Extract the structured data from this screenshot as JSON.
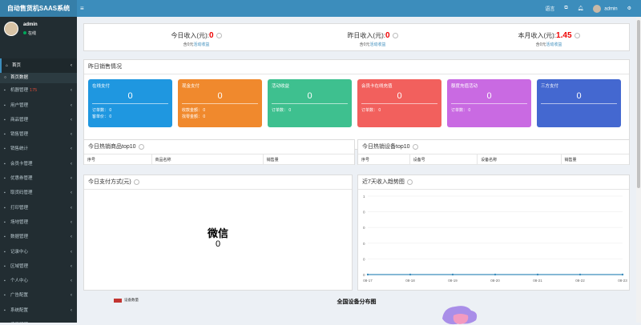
{
  "app": {
    "brand": "自动售货机SAAS系统",
    "toggle": "≡"
  },
  "header": {
    "lang": "语言",
    "user": "admin"
  },
  "sidebar": {
    "user": {
      "name": "admin",
      "status": "在线"
    },
    "items": [
      {
        "label": "首页",
        "icon": "home-icon",
        "active": true
      },
      {
        "label": "首页数据",
        "sub": true
      },
      {
        "label": "机器管理",
        "badge": "175"
      },
      {
        "label": "用户管理"
      },
      {
        "label": "商品管理"
      },
      {
        "label": "销售管理"
      },
      {
        "label": "销售统计"
      },
      {
        "label": "会员卡管理"
      },
      {
        "label": "优惠券管理"
      },
      {
        "label": "取货码管理"
      },
      {
        "label": "打印管理"
      },
      {
        "label": "场地管理"
      },
      {
        "label": "数据管理"
      },
      {
        "label": "记录中心"
      },
      {
        "label": "区域管理"
      },
      {
        "label": "个人中心"
      },
      {
        "label": "广告配置"
      },
      {
        "label": "系统配置"
      },
      {
        "label": "场景管理"
      }
    ]
  },
  "kpi": [
    {
      "label": "今日收入(元):",
      "value": "0",
      "sub1": "含0元",
      "sub2": "活动收益"
    },
    {
      "label": "昨日收入(元):",
      "value": "0",
      "sub1": "含0元",
      "sub2": "活动收益"
    },
    {
      "label": "本月收入(元):",
      "value": "1.45",
      "sub1": "含0元",
      "sub2": "活动收益"
    }
  ],
  "sales": {
    "title": "昨日销售情况",
    "cards": [
      {
        "title": "在线支付",
        "value": "0",
        "l1": "订单数：",
        "v1": "0",
        "l2": "客单价：",
        "v2": "0",
        "color": "#1f97e0"
      },
      {
        "title": "现金支付",
        "value": "0",
        "l1": "收款金额：",
        "v1": "0",
        "l2": "找零金额：",
        "v2": "0",
        "color": "#f0892d"
      },
      {
        "title": "活动收益",
        "value": "0",
        "l1": "订单数：",
        "v1": "0",
        "color": "#3ec08f"
      },
      {
        "title": "会员卡在线充值",
        "value": "0",
        "l1": "订单数：",
        "v1": "0",
        "color": "#f2605d"
      },
      {
        "title": "额度充值活动",
        "value": "0",
        "l1": "订单数：",
        "v1": "0",
        "color": "#c96ae2"
      },
      {
        "title": "三方支付",
        "value": "0",
        "color": "#4468d0"
      }
    ]
  },
  "top_goods": {
    "title": "今日热销商品top10",
    "cols": [
      "序号",
      "商品名称",
      "销售量"
    ]
  },
  "top_devices": {
    "title": "今日热销设备top10",
    "cols": [
      "序号",
      "设备号",
      "设备名称",
      "销售量"
    ]
  },
  "pay": {
    "title": "今日支付方式(元)",
    "name": "微信",
    "value": "0"
  },
  "trend": {
    "title": "近7天收入趋势图"
  },
  "chart_data": {
    "type": "line",
    "title": "近7天收入趋势图",
    "categories": [
      "08-17",
      "08-18",
      "08-19",
      "08-20",
      "08-21",
      "08-22",
      "08-23"
    ],
    "yticks": [
      "1",
      "0",
      "0",
      "0",
      "0",
      "0"
    ],
    "values": [
      0,
      0,
      0,
      0,
      0,
      0,
      0
    ],
    "color": "#3c8dbc"
  },
  "map": {
    "legend": "设备数量",
    "title": "全国设备分布图"
  }
}
